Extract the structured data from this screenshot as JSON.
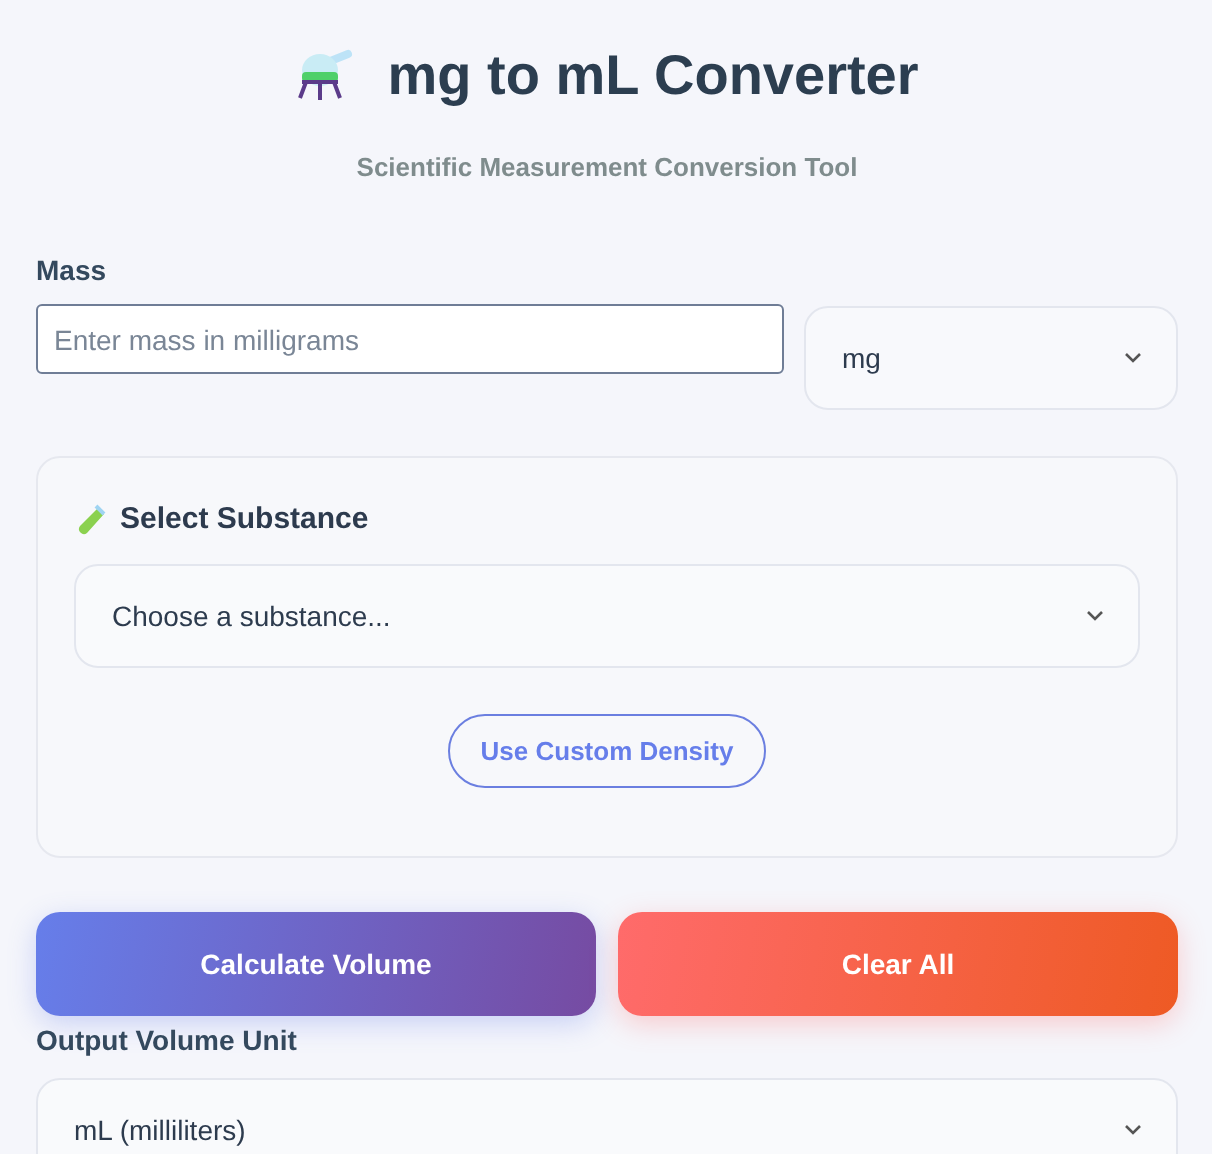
{
  "header": {
    "title": "mg to mL Converter",
    "subtitle": "Scientific Measurement Conversion Tool"
  },
  "mass": {
    "label": "Mass",
    "placeholder": "Enter mass in milligrams",
    "unit": "mg"
  },
  "substance": {
    "heading": "Select Substance",
    "select": "Choose a substance...",
    "custom_button": "Use Custom Density"
  },
  "buttons": [
    {
      "label": "Calculate Volume",
      "kind": "primary"
    },
    {
      "label": "Clear All",
      "kind": "danger"
    }
  ],
  "output": {
    "label": "Output Volume Unit",
    "select": "mL (milliliters)"
  }
}
